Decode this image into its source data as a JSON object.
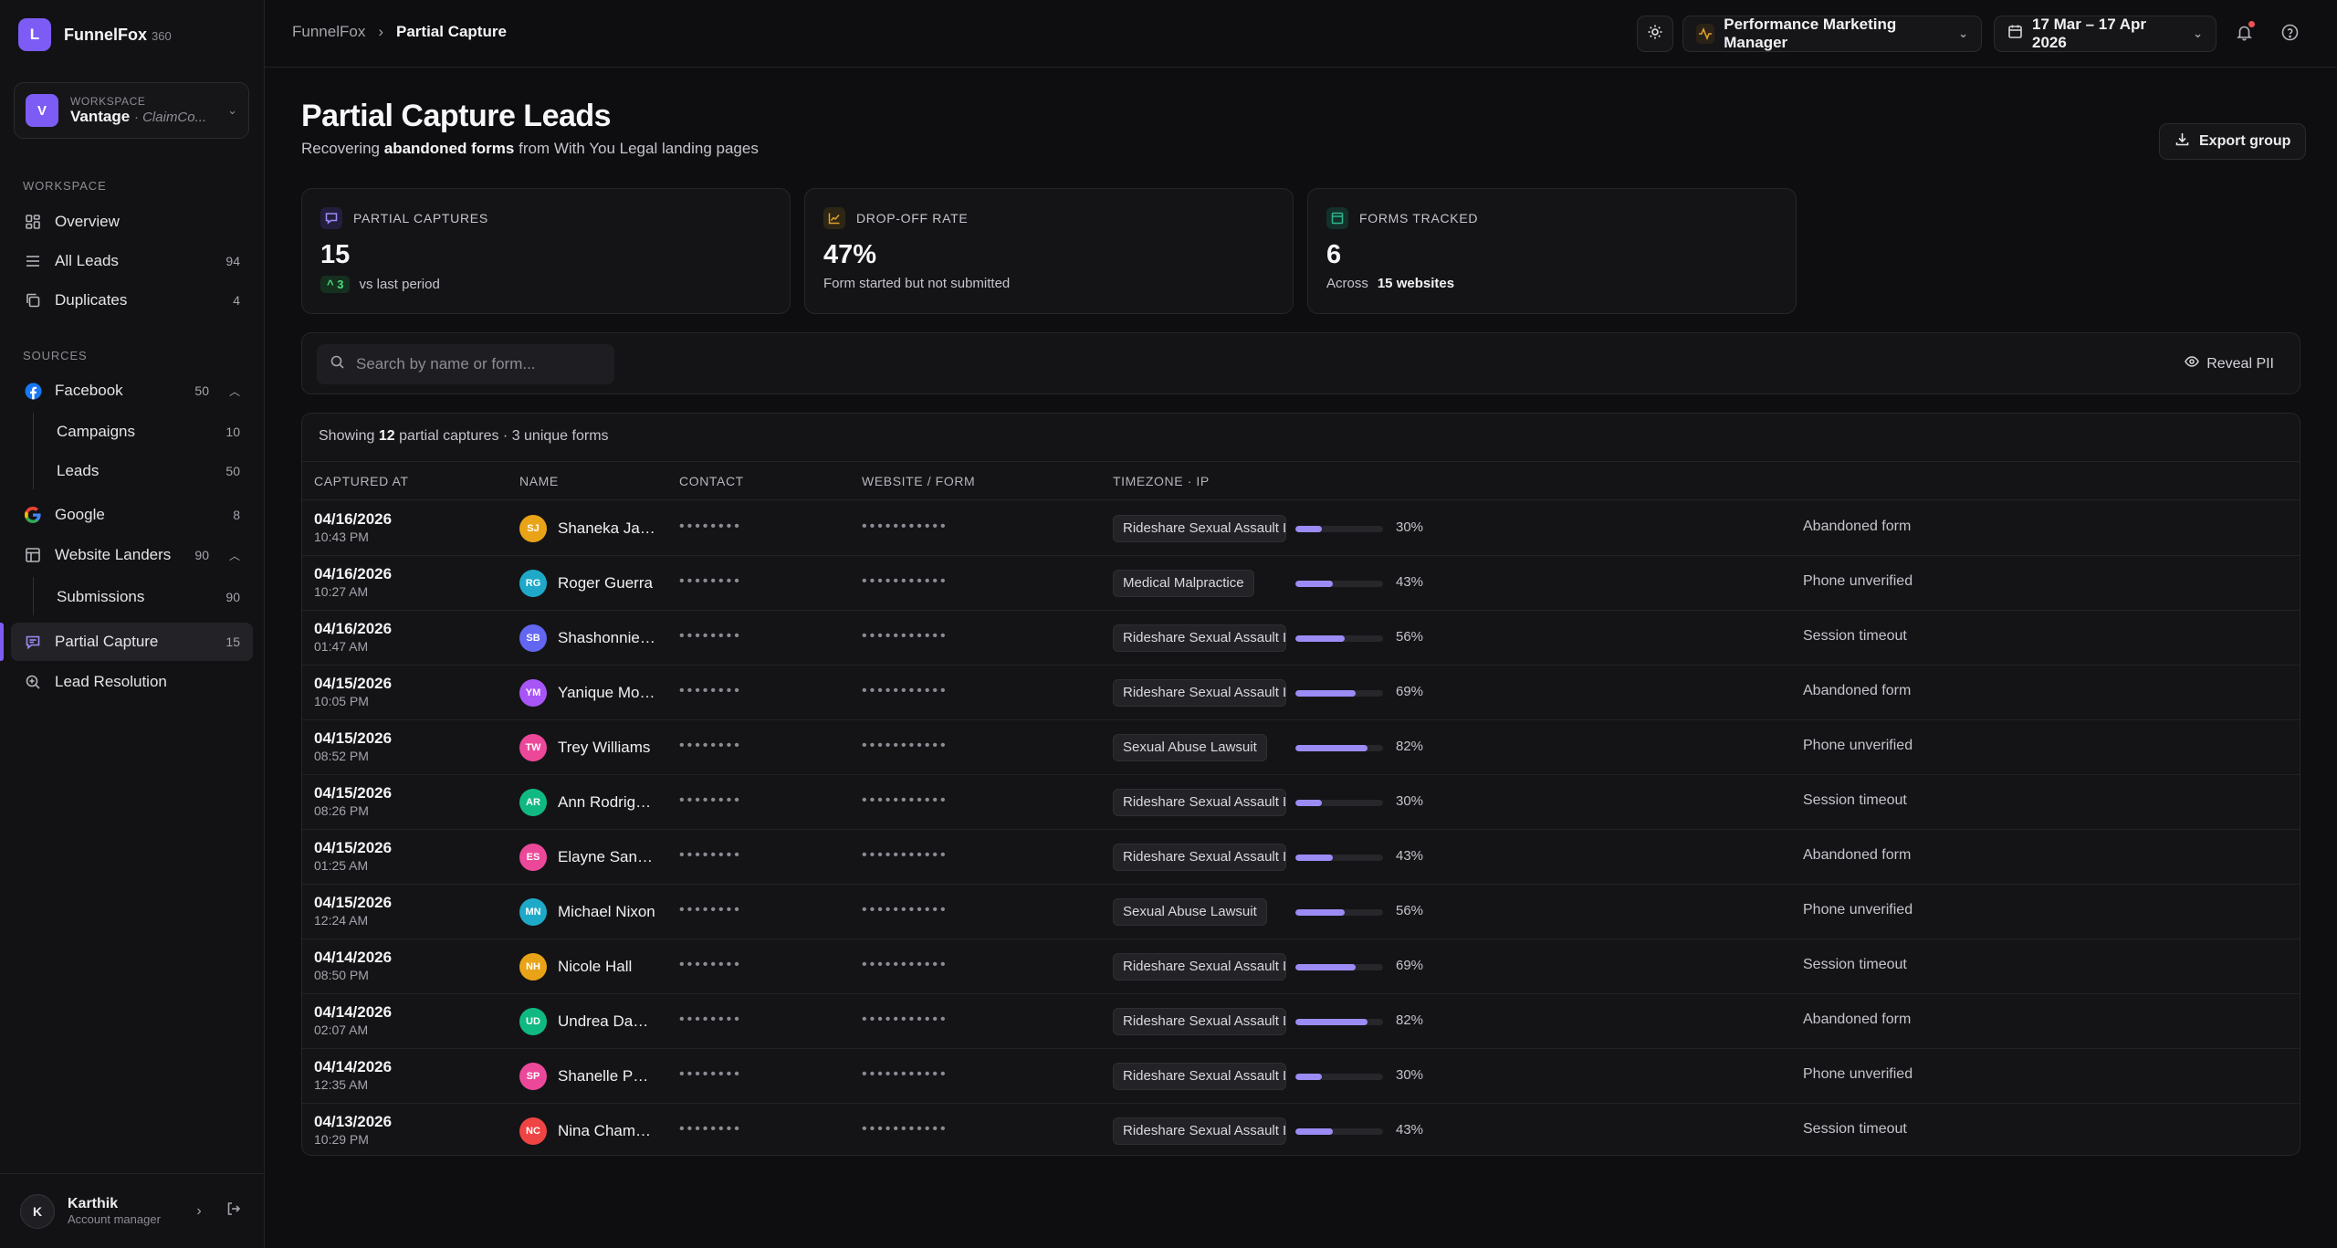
{
  "app": {
    "logo_letter": "L",
    "name": "FunnelFox",
    "name_suffix": "360",
    "accent": "#7c5cf5"
  },
  "workspace_switcher": {
    "label": "WORKSPACE",
    "avatar": "V",
    "name": "Vantage",
    "sub": "· ClaimCo..."
  },
  "sidebar": {
    "section_workspace": "WORKSPACE",
    "section_sources": "SOURCES",
    "items": [
      {
        "label": "Overview",
        "icon": "grid-icon"
      },
      {
        "label": "All Leads",
        "count": "94",
        "icon": "list-icon"
      },
      {
        "label": "Duplicates",
        "count": "4",
        "icon": "copy-icon"
      },
      {
        "label": "Facebook",
        "count": "50",
        "icon": "facebook-icon"
      },
      {
        "label": "Campaigns",
        "count": "10"
      },
      {
        "label": "Leads",
        "count": "50"
      },
      {
        "label": "Google",
        "count": "8",
        "icon": "google-icon"
      },
      {
        "label": "Website Landers",
        "count": "90",
        "icon": "layout-icon"
      },
      {
        "label": "Submissions",
        "count": "90"
      },
      {
        "label": "Partial Capture",
        "count": "15",
        "icon": "message-icon"
      },
      {
        "label": "Lead Resolution",
        "icon": "zoom-icon"
      }
    ]
  },
  "user": {
    "initial": "K",
    "name": "Karthik",
    "role": "Account manager"
  },
  "topbar": {
    "crumb_root": "FunnelFox",
    "crumb_current": "Partial Capture",
    "role_selector": "Performance Marketing Manager",
    "date_range": "17 Mar – 17 Apr 2026"
  },
  "page": {
    "title": "Partial Capture Leads",
    "subtitle_prefix": "Recovering",
    "subtitle_bold": "abandoned forms",
    "subtitle_suffix": "from With You Legal landing pages",
    "export_label": "Export group"
  },
  "kpis": [
    {
      "label": "PARTIAL CAPTURES",
      "value": "15",
      "delta": "^ 3",
      "foot": "vs last period",
      "icon_color": "#7c5cf5"
    },
    {
      "label": "DROP-OFF RATE",
      "value": "47%",
      "foot": "Form started but not submitted",
      "icon_color": "#e0a030"
    },
    {
      "label": "FORMS TRACKED",
      "value": "6",
      "foot_prefix": "Across",
      "foot_bold": "15 websites",
      "icon_color": "#2fb58a"
    }
  ],
  "search": {
    "placeholder": "Search by name or form...",
    "reveal_label": "Reveal PII"
  },
  "table": {
    "caption_prefix": "Showing",
    "caption_count": "12",
    "caption_suffix": "partial captures · 3 unique forms",
    "columns": [
      "CAPTURED AT",
      "NAME",
      "CONTACT",
      "WEBSITE / FORM",
      "TIMEZONE · IP"
    ],
    "rows": [
      {
        "date": "04/16/2026",
        "time": "10:43 PM",
        "initials": "SJ",
        "avatar_color": "#e8a317",
        "name": "Shaneka Jac...",
        "contact": "••••••••",
        "website": "•••••••••••",
        "form": "Rideshare Sexual Assault L",
        "progress": 30,
        "progress_label": "30%",
        "reason": "Abandoned form"
      },
      {
        "date": "04/16/2026",
        "time": "10:27 AM",
        "initials": "RG",
        "avatar_color": "#1fa9c9",
        "name": "Roger Guerra",
        "contact": "••••••••",
        "website": "•••••••••••",
        "form": "Medical Malpractice",
        "progress": 43,
        "progress_label": "43%",
        "reason": "Phone unverified"
      },
      {
        "date": "04/16/2026",
        "time": "01:47 AM",
        "initials": "SB",
        "avatar_color": "#6366f1",
        "name": "Shashonnie ...",
        "contact": "••••••••",
        "website": "•••••••••••",
        "form": "Rideshare Sexual Assault L",
        "progress": 56,
        "progress_label": "56%",
        "reason": "Session timeout"
      },
      {
        "date": "04/15/2026",
        "time": "10:05 PM",
        "initials": "YM",
        "avatar_color": "#a855f7",
        "name": "Yanique Morr...",
        "contact": "••••••••",
        "website": "•••••••••••",
        "form": "Rideshare Sexual Assault L",
        "progress": 69,
        "progress_label": "69%",
        "reason": "Abandoned form"
      },
      {
        "date": "04/15/2026",
        "time": "08:52 PM",
        "initials": "TW",
        "avatar_color": "#ec4899",
        "name": "Trey Williams",
        "contact": "••••••••",
        "website": "•••••••••••",
        "form": "Sexual Abuse Lawsuit",
        "progress": 82,
        "progress_label": "82%",
        "reason": "Phone unverified"
      },
      {
        "date": "04/15/2026",
        "time": "08:26 PM",
        "initials": "AR",
        "avatar_color": "#10b981",
        "name": "Ann Rodrigu...",
        "contact": "••••••••",
        "website": "•••••••••••",
        "form": "Rideshare Sexual Assault L",
        "progress": 30,
        "progress_label": "30%",
        "reason": "Session timeout"
      },
      {
        "date": "04/15/2026",
        "time": "01:25 AM",
        "initials": "ES",
        "avatar_color": "#ec4899",
        "name": "Elayne Santos",
        "contact": "••••••••",
        "website": "•••••••••••",
        "form": "Rideshare Sexual Assault L",
        "progress": 43,
        "progress_label": "43%",
        "reason": "Abandoned form"
      },
      {
        "date": "04/15/2026",
        "time": "12:24 AM",
        "initials": "MN",
        "avatar_color": "#1fa9c9",
        "name": "Michael Nixon",
        "contact": "••••••••",
        "website": "•••••••••••",
        "form": "Sexual Abuse Lawsuit",
        "progress": 56,
        "progress_label": "56%",
        "reason": "Phone unverified"
      },
      {
        "date": "04/14/2026",
        "time": "08:50 PM",
        "initials": "NH",
        "avatar_color": "#e8a317",
        "name": "Nicole Hall",
        "contact": "••••••••",
        "website": "•••••••••••",
        "form": "Rideshare Sexual Assault L",
        "progress": 69,
        "progress_label": "69%",
        "reason": "Session timeout"
      },
      {
        "date": "04/14/2026",
        "time": "02:07 AM",
        "initials": "UD",
        "avatar_color": "#10b981",
        "name": "Undrea Dancy",
        "contact": "••••••••",
        "website": "•••••••••••",
        "form": "Rideshare Sexual Assault L",
        "progress": 82,
        "progress_label": "82%",
        "reason": "Abandoned form"
      },
      {
        "date": "04/14/2026",
        "time": "12:35 AM",
        "initials": "SP",
        "avatar_color": "#ec4899",
        "name": "Shanelle Patt...",
        "contact": "••••••••",
        "website": "•••••••••••",
        "form": "Rideshare Sexual Assault L",
        "progress": 30,
        "progress_label": "30%",
        "reason": "Phone unverified"
      },
      {
        "date": "04/13/2026",
        "time": "10:29 PM",
        "initials": "NC",
        "avatar_color": "#ef4444",
        "name": "Nina Chamb...",
        "contact": "••••••••",
        "website": "•••••••••••",
        "form": "Rideshare Sexual Assault L",
        "progress": 43,
        "progress_label": "43%",
        "reason": "Session timeout"
      }
    ]
  }
}
